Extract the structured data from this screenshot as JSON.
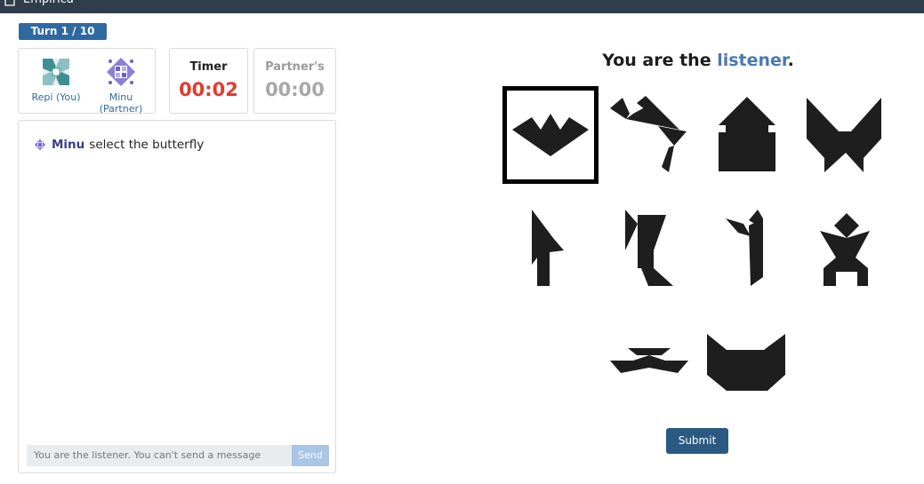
{
  "app": {
    "title": "Empirica",
    "logo_icon": "puzzle-icon"
  },
  "turn": {
    "label": "Turn 1 / 10"
  },
  "players": [
    {
      "name": "Repi (You)",
      "avatar_icon": "teal-quilt-avatar"
    },
    {
      "name": "Minu (Partner)",
      "avatar_icon": "purple-quilt-avatar"
    }
  ],
  "timer": {
    "label": "Timer",
    "value": "00:02"
  },
  "partner_timer": {
    "label": "Partner's",
    "value": "00:00"
  },
  "chat": {
    "messages": [
      {
        "sender": "Minu",
        "text": "select the butterfly",
        "avatar_icon": "purple-quilt-avatar"
      }
    ],
    "input_placeholder": "You are the listener. You can't send a message",
    "send_label": "Send"
  },
  "headline": {
    "prefix": "You are the ",
    "role": "listener",
    "suffix": "."
  },
  "tangrams": [
    {
      "id": "tangram-1",
      "shape": "bat",
      "selected": true
    },
    {
      "id": "tangram-2",
      "shape": "dancer",
      "selected": false
    },
    {
      "id": "tangram-3",
      "shape": "house",
      "selected": false
    },
    {
      "id": "tangram-4",
      "shape": "butterfly",
      "selected": false
    },
    {
      "id": "tangram-5",
      "shape": "bird-left",
      "selected": false
    },
    {
      "id": "tangram-6",
      "shape": "figure-flag",
      "selected": false
    },
    {
      "id": "tangram-7",
      "shape": "figure-hook",
      "selected": false
    },
    {
      "id": "tangram-8",
      "shape": "person-legs",
      "selected": false
    },
    {
      "id": "tangram-9",
      "shape": "boat",
      "selected": false
    },
    {
      "id": "tangram-10",
      "shape": "cat",
      "selected": false
    }
  ],
  "submit_label": "Submit",
  "colors": {
    "accent": "#2e6aa1",
    "timer": "#e23b2e",
    "role": "#4a78b3",
    "submit": "#2a5a82"
  }
}
